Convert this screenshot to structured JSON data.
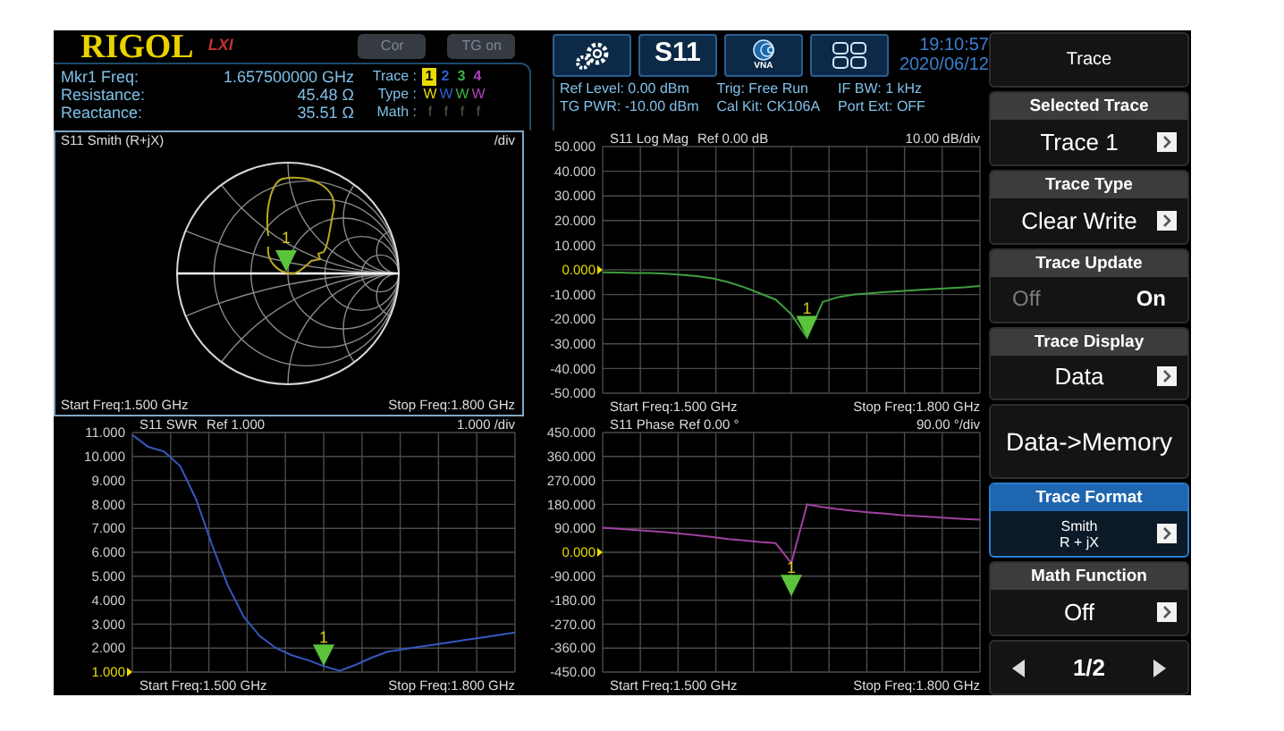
{
  "header": {
    "logo": "RIGOL",
    "logo_badge": "LXI",
    "status_buttons": [
      "Cor",
      "TG on"
    ],
    "marker_readout": [
      {
        "label": "Mkr1 Freq:",
        "value": "1.657500000 GHz"
      },
      {
        "label": "Resistance:",
        "value": "45.48 Ω"
      },
      {
        "label": "Reactance:",
        "value": "35.51 Ω"
      }
    ],
    "trace_legend": {
      "row_labels": [
        "Trace :",
        "Type :",
        "Math :"
      ],
      "traces": [
        {
          "number": "1",
          "type": "W",
          "math": "f",
          "color": "#e8dc00",
          "selected": true
        },
        {
          "number": "2",
          "type": "W",
          "math": "f",
          "color": "#2f5fd0",
          "selected": false
        },
        {
          "number": "3",
          "type": "W",
          "math": "f",
          "color": "#3cb043",
          "selected": false
        },
        {
          "number": "4",
          "type": "W",
          "math": "f",
          "color": "#b040c0",
          "selected": false
        }
      ]
    },
    "toolbar": [
      {
        "kind": "gear"
      },
      {
        "kind": "text",
        "label": "S11"
      },
      {
        "kind": "vna",
        "label": "VNA"
      },
      {
        "kind": "layout"
      }
    ],
    "clock": {
      "time": "19:10:57",
      "date": "2020/06/12"
    },
    "settings": [
      [
        "Ref Level: 0.00 dBm",
        "TG PWR: -10.00 dBm"
      ],
      [
        "Trig: Free Run",
        "Cal Kit: CK106A"
      ],
      [
        "IF BW: 1 kHz",
        "Port Ext: OFF"
      ]
    ]
  },
  "panels": [
    {
      "kind": "smith",
      "title": "S11 Smith (R+jX)",
      "scale": "/div",
      "start": "Start Freq:1.500 GHz",
      "stop": "Stop Freq:1.800 GHz",
      "marker": "1"
    },
    {
      "kind": "cartesian",
      "ref": "Ref 0.00 dB",
      "scale": "10.00 dB/div",
      "start": "Start Freq:1.500 GHz",
      "stop": "Stop Freq:1.800 GHz",
      "chart_data": {
        "type": "line",
        "title": "S11 Log Mag",
        "categories": [
          null,
          null,
          null,
          null,
          null,
          null,
          null,
          null,
          null,
          null,
          null,
          null,
          null,
          null,
          null,
          null,
          null,
          null,
          null,
          null,
          null,
          null,
          null,
          null,
          null
        ],
        "series": [
          {
            "color": "#3f9f3f",
            "values": [
              -1,
              -1.1,
              -1.2,
              -1.3,
              -1.5,
              -2,
              -2.5,
              -3.5,
              -5,
              -7,
              -9.5,
              -12,
              -18,
              -27.5,
              -13,
              -11,
              -10,
              -9.5,
              -9,
              -8.6,
              -8.2,
              -7.8,
              -7.4,
              -7,
              -6.5
            ]
          },
          {
            "name": "1",
            "color": "#5cc43c",
            "marker": "triangle-down",
            "values": [
              null,
              null,
              null,
              null,
              null,
              null,
              null,
              null,
              null,
              null,
              null,
              null,
              null,
              -23,
              null,
              null,
              null,
              null,
              null,
              null,
              null,
              null,
              null,
              null,
              null
            ]
          }
        ],
        "grid": true,
        "ylim": [
          -50,
          50
        ],
        "yticks": [
          {
            "value": 50,
            "label": "50.000"
          },
          {
            "value": 40,
            "label": "40.000"
          },
          {
            "value": 30,
            "label": "30.000"
          },
          {
            "value": 20,
            "label": "20.000"
          },
          {
            "value": 10,
            "label": "10.000"
          },
          {
            "value": 0,
            "label": "0.000"
          },
          {
            "value": -10,
            "label": "-10.000"
          },
          {
            "value": -20,
            "label": "-20.000"
          },
          {
            "value": -30,
            "label": "-30.000"
          },
          {
            "value": -40,
            "label": "-40.000"
          },
          {
            "value": -50,
            "label": "-50.000"
          }
        ]
      },
      "reference_at_bottom": false
    },
    {
      "kind": "cartesian",
      "ref": "Ref 1.000",
      "scale": "1.000 /div",
      "start": "Start Freq:1.500 GHz",
      "stop": "Stop Freq:1.800 GHz",
      "chart_data": {
        "type": "line",
        "title": "S11 SWR",
        "categories": [
          null,
          null,
          null,
          null,
          null,
          null,
          null,
          null,
          null,
          null,
          null,
          null,
          null,
          null,
          null,
          null,
          null,
          null,
          null,
          null,
          null,
          null,
          null,
          null,
          null
        ],
        "series": [
          {
            "color": "#3558c0",
            "values": [
              10.9,
              10.4,
              10.2,
              9.6,
              8.2,
              6.3,
              4.6,
              3.3,
              2.5,
              2,
              1.7,
              1.5,
              1.25,
              1.05,
              1.3,
              1.6,
              1.85,
              1.95,
              2.05,
              2.15,
              2.25,
              2.35,
              2.45,
              2.55,
              2.65
            ]
          },
          {
            "name": "1",
            "color": "#5cc43c",
            "marker": "triangle-down",
            "values": [
              null,
              null,
              null,
              null,
              null,
              null,
              null,
              null,
              null,
              null,
              null,
              null,
              1.7,
              null,
              null,
              null,
              null,
              null,
              null,
              null,
              null,
              null,
              null,
              null,
              null
            ]
          }
        ],
        "grid": true,
        "ylim": [
          1,
          11
        ],
        "yticks": [
          {
            "value": 11,
            "label": "11.000"
          },
          {
            "value": 10,
            "label": "10.000"
          },
          {
            "value": 9,
            "label": "9.000"
          },
          {
            "value": 8,
            "label": "8.000"
          },
          {
            "value": 7,
            "label": "7.000"
          },
          {
            "value": 6,
            "label": "6.000"
          },
          {
            "value": 5,
            "label": "5.000"
          },
          {
            "value": 4,
            "label": "4.000"
          },
          {
            "value": 3,
            "label": "3.000"
          },
          {
            "value": 2,
            "label": "2.000"
          },
          {
            "value": 1,
            "label": "1.000"
          }
        ]
      },
      "reference_at_bottom": true
    },
    {
      "kind": "cartesian",
      "ref": "Ref 0.00 °",
      "scale": "90.00 °/div",
      "start": "Start Freq:1.500 GHz",
      "stop": "Stop Freq:1.800 GHz",
      "chart_data": {
        "type": "line",
        "title": "S11 Phase",
        "categories": [
          null,
          null,
          null,
          null,
          null,
          null,
          null,
          null,
          null,
          null,
          null,
          null,
          null,
          null,
          null,
          null,
          null,
          null,
          null,
          null,
          null,
          null,
          null,
          null,
          null
        ],
        "series": [
          {
            "color": "#a040a0",
            "values": [
              92,
              88,
              84,
              80,
              75,
              70,
              64,
              57,
              50,
              44,
              38,
              34,
              -40,
              180,
              170,
              162,
              155,
              150,
              145,
              140,
              136,
              132,
              128,
              125,
              122
            ]
          },
          {
            "name": "1",
            "color": "#5cc43c",
            "marker": "triangle-down",
            "values": [
              null,
              null,
              null,
              null,
              null,
              null,
              null,
              null,
              null,
              null,
              null,
              null,
              -125,
              null,
              null,
              null,
              null,
              null,
              null,
              null,
              null,
              null,
              null,
              null,
              null
            ]
          }
        ],
        "grid": true,
        "ylim": [
          -450,
          450
        ],
        "yticks": [
          {
            "value": 450,
            "label": "450.000"
          },
          {
            "value": 360,
            "label": "360.000"
          },
          {
            "value": 270,
            "label": "270.000"
          },
          {
            "value": 180,
            "label": "180.000"
          },
          {
            "value": 90,
            "label": "90.000"
          },
          {
            "value": 0,
            "label": "0.000"
          },
          {
            "value": -90,
            "label": "-90.000"
          },
          {
            "value": -180,
            "label": "-180.00"
          },
          {
            "value": -270,
            "label": "-270.00"
          },
          {
            "value": -360,
            "label": "-360.00"
          },
          {
            "value": -450,
            "label": "-450.00"
          }
        ]
      },
      "reference_at_bottom": false
    }
  ],
  "menu": [
    {
      "kind": "button",
      "label": "Trace",
      "selected": false
    },
    {
      "kind": "select",
      "title": "Selected Trace",
      "lines": [
        "Trace 1"
      ],
      "selected": false
    },
    {
      "kind": "select",
      "title": "Trace Type",
      "lines": [
        "Clear Write"
      ],
      "selected": false
    },
    {
      "kind": "toggle",
      "title": "Trace Update",
      "options": [
        {
          "label": "Off",
          "selected": false
        },
        {
          "label": "On",
          "selected": true
        }
      ],
      "selected": false
    },
    {
      "kind": "select",
      "title": "Trace Display",
      "lines": [
        "Data"
      ],
      "selected": false
    },
    {
      "kind": "button",
      "label": "Data->Memory",
      "selected": false
    },
    {
      "kind": "select",
      "title": "Trace Format",
      "lines": [
        "Smith",
        "R + jX"
      ],
      "selected": true
    },
    {
      "kind": "select",
      "title": "Math Function",
      "lines": [
        "Off"
      ],
      "selected": false
    },
    {
      "kind": "pager",
      "page": "1/2"
    }
  ]
}
